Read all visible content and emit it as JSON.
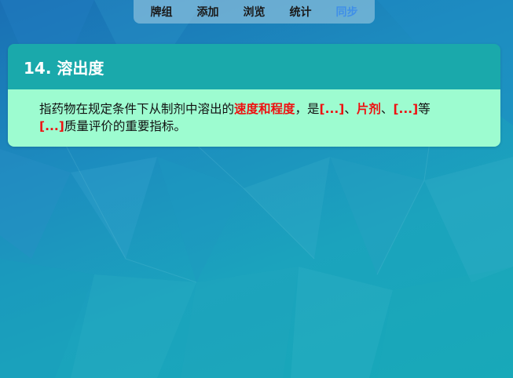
{
  "nav": {
    "items": [
      {
        "label": "牌组",
        "active": false
      },
      {
        "label": "添加",
        "active": false
      },
      {
        "label": "浏览",
        "active": false
      },
      {
        "label": "统计",
        "active": false
      },
      {
        "label": "同步",
        "active": true
      }
    ],
    "active_color": "#3f8fe8"
  },
  "card": {
    "title": "14. 溶出度",
    "body": {
      "t1": "指药物在规定条件下从制剂中溶出的",
      "c1": "速度和程度",
      "t2": "，是",
      "c2": "[...]",
      "t3": "、",
      "c3": "片剂",
      "t4": "、",
      "c4": "[...]",
      "t5": "等",
      "c5": "[...]",
      "t6": "质量评价的重要指标。"
    },
    "header_color": "#1aa9ab",
    "body_color": "#9dfcd0",
    "cloze_color": "#ee1111"
  }
}
